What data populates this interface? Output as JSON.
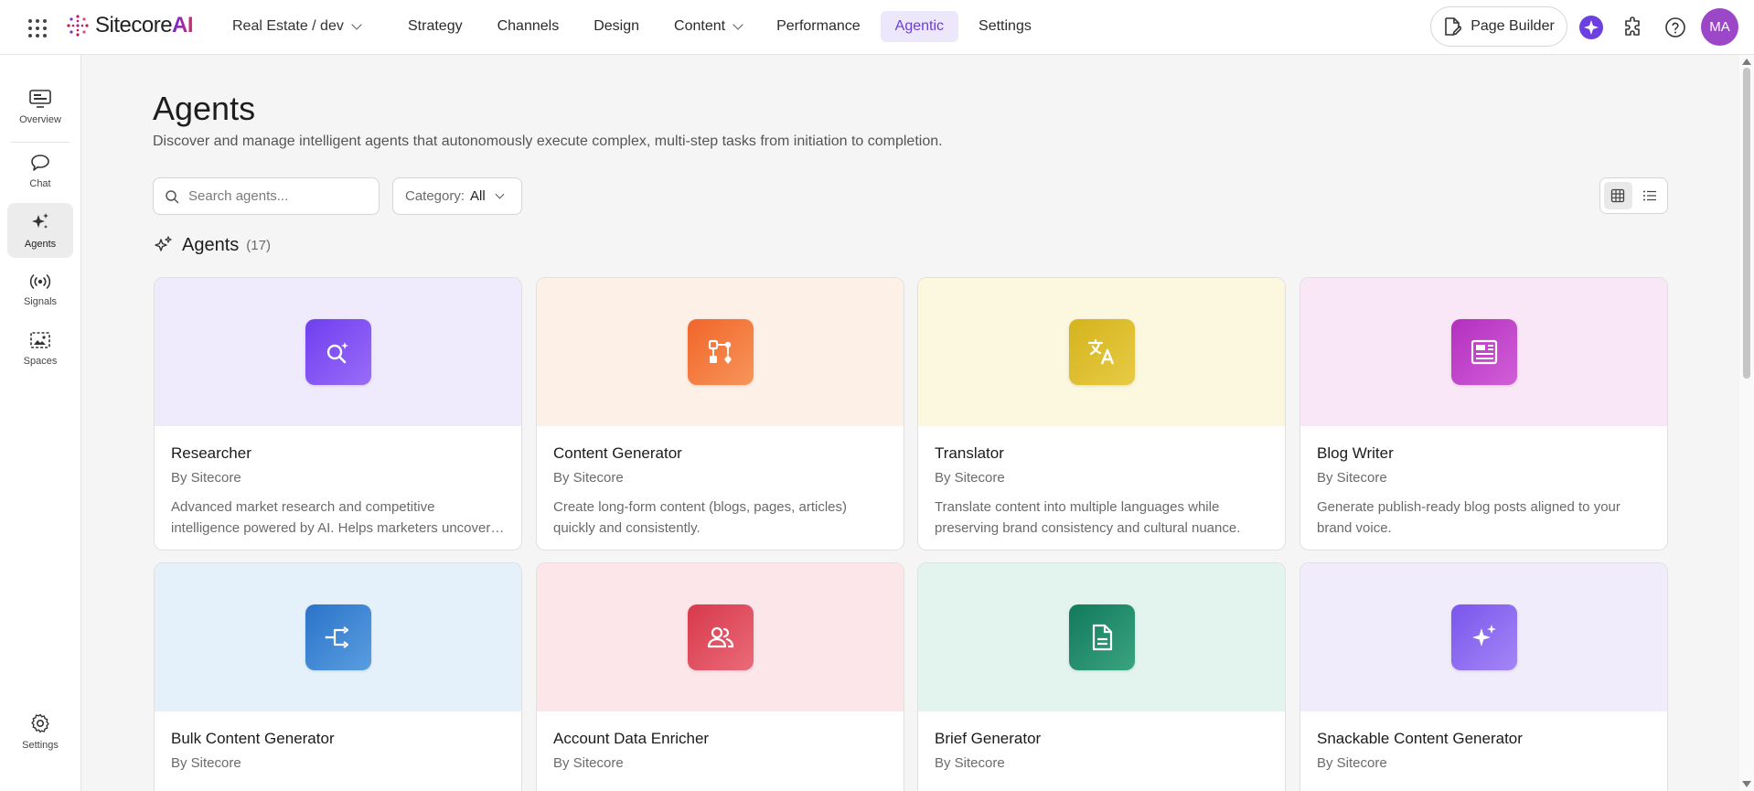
{
  "app": {
    "brand": "SitecoreAI",
    "brand_prefix": "Sitecore",
    "brand_suffix": "AI",
    "environment": "Real Estate / dev"
  },
  "nav": [
    {
      "label": "Strategy",
      "active": false
    },
    {
      "label": "Channels",
      "active": false
    },
    {
      "label": "Design",
      "active": false
    },
    {
      "label": "Content",
      "active": false,
      "has_dropdown": true
    },
    {
      "label": "Performance",
      "active": false
    },
    {
      "label": "Agentic",
      "active": true
    },
    {
      "label": "Settings",
      "active": false
    }
  ],
  "header_actions": {
    "page_builder": "Page Builder",
    "avatar_initials": "MA"
  },
  "sidebar": {
    "items": [
      {
        "label": "Overview",
        "icon": "monitor-icon"
      },
      {
        "label": "Chat",
        "icon": "chat-icon"
      },
      {
        "label": "Agents",
        "icon": "sparkle-icon",
        "active": true
      },
      {
        "label": "Signals",
        "icon": "broadcast-icon"
      },
      {
        "label": "Spaces",
        "icon": "image-frame-icon"
      }
    ],
    "bottom": {
      "label": "Settings",
      "icon": "gear-icon"
    }
  },
  "main": {
    "title": "Agents",
    "description": "Discover and manage intelligent agents that autonomously execute complex, multi-step tasks from initiation to completion.",
    "search_placeholder": "Search agents...",
    "category_label": "Category:",
    "category_value": "All",
    "section_title": "Agents",
    "section_count": "(17)"
  },
  "agents": [
    {
      "name": "Researcher",
      "by": "By Sitecore",
      "description": "Advanced market research and competitive intelligence powered by AI. Helps marketers uncover insights.",
      "icon": "magnify-sparkle-icon",
      "banner": "#efeafc",
      "tile": [
        "#6f3ff0",
        "#9a6cf7"
      ]
    },
    {
      "name": "Content Generator",
      "by": "By Sitecore",
      "description": "Create long-form content (blogs, pages, articles) quickly and consistently.",
      "icon": "workflow-icon",
      "banner": "#fdf0e6",
      "tile": [
        "#f1652a",
        "#f7955a"
      ]
    },
    {
      "name": "Translator",
      "by": "By Sitecore",
      "description": "Translate content into multiple languages while preserving brand consistency and cultural nuance.",
      "icon": "translate-icon",
      "banner": "#fcf7df",
      "tile": [
        "#d4b31d",
        "#e8cb45"
      ]
    },
    {
      "name": "Blog Writer",
      "by": "By Sitecore",
      "description": "Generate publish-ready blog posts aligned to your brand voice.",
      "icon": "article-icon",
      "banner": "#f9e6f6",
      "tile": [
        "#b32fbf",
        "#d15fd8"
      ]
    },
    {
      "name": "Bulk Content Generator",
      "by": "By Sitecore",
      "description": "",
      "icon": "branch-icon",
      "banner": "#e5f1fa",
      "tile": [
        "#2a73c9",
        "#5a9ee0"
      ]
    },
    {
      "name": "Account Data Enricher",
      "by": "By Sitecore",
      "description": "",
      "icon": "people-icon",
      "banner": "#fce6ea",
      "tile": [
        "#d7394c",
        "#ea6b79"
      ]
    },
    {
      "name": "Brief Generator",
      "by": "By Sitecore",
      "description": "",
      "icon": "document-icon",
      "banner": "#e3f3ee",
      "tile": [
        "#127a5c",
        "#3aa37f"
      ]
    },
    {
      "name": "Snackable Content Generator",
      "by": "By Sitecore",
      "description": "",
      "icon": "sparkles-icon",
      "banner": "#f0ecfc",
      "tile": [
        "#7a55ec",
        "#a487f6"
      ]
    }
  ]
}
